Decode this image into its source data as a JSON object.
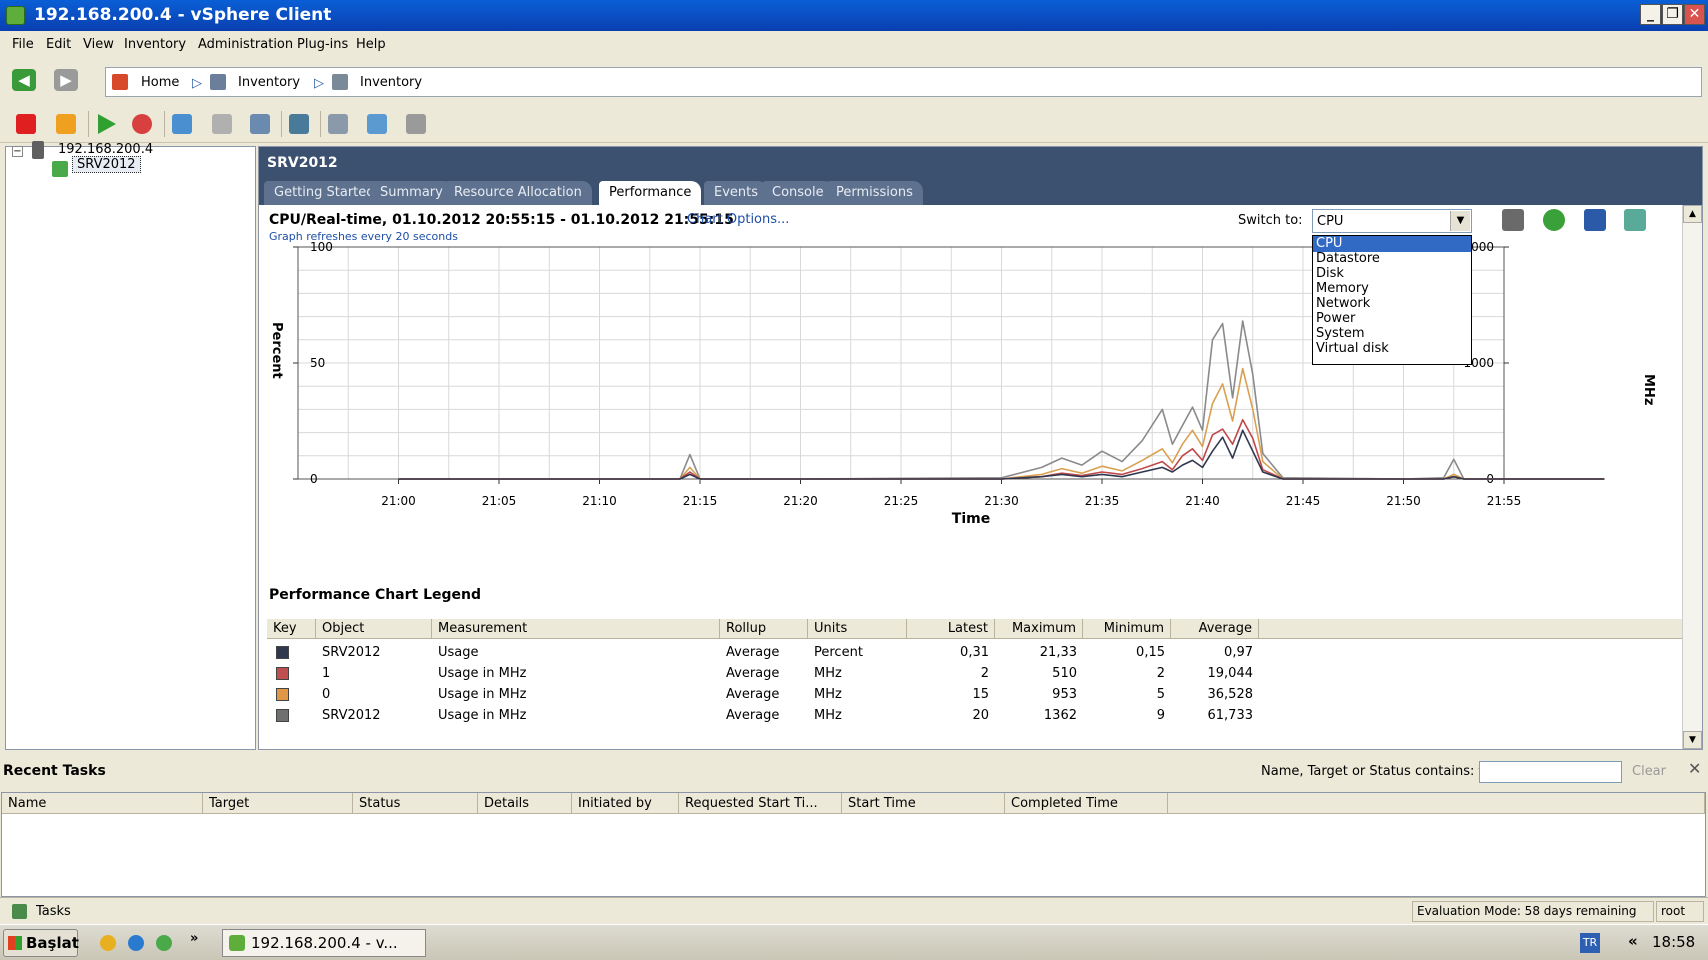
{
  "window": {
    "title": "192.168.200.4 - vSphere Client",
    "min": "_",
    "max": "❐",
    "close": "✕"
  },
  "menu": [
    "File",
    "Edit",
    "View",
    "Inventory",
    "Administration",
    "Plug-ins",
    "Help"
  ],
  "breadcrumb": {
    "home": "Home",
    "item1": "Inventory",
    "item2": "Inventory"
  },
  "tree": {
    "host": "192.168.200.4",
    "vm": "SRV2012",
    "expander": "−"
  },
  "panel": {
    "title": "SRV2012",
    "tabs": [
      "Getting Started",
      "Summary",
      "Resource Allocation",
      "Performance",
      "Events",
      "Console",
      "Permissions"
    ],
    "active_tab": "Performance"
  },
  "chart_header": {
    "title": "CPU/Real-time, 01.10.2012 20:55:15 - 01.10.2012 21:55:15",
    "options_link": "Chart Options...",
    "refresh_note": "Graph refreshes every 20 seconds",
    "switch_label": "Switch to:",
    "switch_value": "CPU",
    "switch_options": [
      "CPU",
      "Datastore",
      "Disk",
      "Memory",
      "Network",
      "Power",
      "System",
      "Virtual disk"
    ]
  },
  "chart_data": {
    "type": "line",
    "xlabel": "Time",
    "ylabel": "Percent",
    "y2label": "MHz",
    "ylim": [
      0,
      100
    ],
    "y2lim": [
      0,
      2000
    ],
    "yticks": [
      "100",
      "50",
      "0"
    ],
    "y2ticks": [
      "2000",
      "1000",
      "0"
    ],
    "xticks": [
      "21:00",
      "21:05",
      "21:10",
      "21:15",
      "21:20",
      "21:25",
      "21:30",
      "21:35",
      "21:40",
      "21:45",
      "21:50",
      "21:55"
    ],
    "x_minutes": [
      0,
      7,
      14,
      14.5,
      15,
      20,
      30,
      32,
      33,
      34,
      35,
      36,
      37,
      38,
      38.5,
      39,
      39.5,
      40,
      40.5,
      41,
      41.5,
      42,
      42.5,
      43,
      44,
      50,
      52,
      52.5,
      53,
      60
    ],
    "series": [
      {
        "name": "SRV2012 Usage",
        "unit": "%",
        "color": "#303850",
        "values": [
          0,
          0,
          0,
          2,
          0,
          0,
          0,
          1,
          2,
          1,
          2,
          1,
          3,
          5,
          3,
          6,
          8,
          5,
          12,
          18,
          9,
          21,
          12,
          3,
          0,
          0,
          0,
          1,
          0,
          0
        ]
      },
      {
        "name": "1 Usage in MHz",
        "unit": "MHz",
        "color": "#c04848",
        "values": [
          0,
          0,
          0,
          60,
          0,
          0,
          0,
          20,
          50,
          30,
          60,
          40,
          90,
          150,
          80,
          200,
          260,
          160,
          380,
          430,
          300,
          510,
          350,
          80,
          0,
          0,
          0,
          20,
          0,
          0
        ]
      },
      {
        "name": "0 Usage in MHz",
        "unit": "MHz",
        "color": "#d8a050",
        "values": [
          0,
          0,
          0,
          100,
          0,
          0,
          0,
          40,
          90,
          50,
          110,
          70,
          160,
          260,
          140,
          300,
          420,
          280,
          650,
          820,
          500,
          953,
          600,
          150,
          0,
          0,
          0,
          40,
          0,
          0
        ]
      },
      {
        "name": "SRV2012 Usage in MHz",
        "unit": "MHz",
        "color": "#8a8a8a",
        "values": [
          0,
          0,
          0,
          210,
          0,
          0,
          10,
          100,
          180,
          120,
          240,
          150,
          330,
          600,
          300,
          460,
          620,
          420,
          1200,
          1340,
          700,
          1362,
          900,
          220,
          10,
          0,
          10,
          170,
          0,
          0
        ]
      }
    ]
  },
  "legend": {
    "title": "Performance Chart Legend",
    "headers": [
      "Key",
      "Object",
      "Measurement",
      "Rollup",
      "Units",
      "Latest",
      "Maximum",
      "Minimum",
      "Average"
    ],
    "rows": [
      {
        "color": "#303850",
        "object": "SRV2012",
        "measurement": "Usage",
        "rollup": "Average",
        "units": "Percent",
        "latest": "0,31",
        "maximum": "21,33",
        "minimum": "0,15",
        "average": "0,97"
      },
      {
        "color": "#c05050",
        "object": "1",
        "measurement": "Usage in MHz",
        "rollup": "Average",
        "units": "MHz",
        "latest": "2",
        "maximum": "510",
        "minimum": "2",
        "average": "19,044"
      },
      {
        "color": "#e09848",
        "object": "0",
        "measurement": "Usage in MHz",
        "rollup": "Average",
        "units": "MHz",
        "latest": "15",
        "maximum": "953",
        "minimum": "5",
        "average": "36,528"
      },
      {
        "color": "#707070",
        "object": "SRV2012",
        "measurement": "Usage in MHz",
        "rollup": "Average",
        "units": "MHz",
        "latest": "20",
        "maximum": "1362",
        "minimum": "9",
        "average": "61,733"
      }
    ]
  },
  "recent_tasks": {
    "title": "Recent Tasks",
    "filter_label": "Name, Target or Status contains: ▾",
    "filter_value": "",
    "clear": "Clear",
    "close": "✕",
    "headers": [
      "Name",
      "Target",
      "Status",
      "Details",
      "Initiated by",
      "Requested Start Ti...",
      "Start Time",
      "Completed Time"
    ]
  },
  "status": {
    "tasks": "Tasks",
    "evaluation": "Evaluation Mode: 58 days remaining",
    "user": "root"
  },
  "taskbar": {
    "start": "Başlat",
    "item": "192.168.200.4 - v...",
    "lang": "TR",
    "clock": "18:58",
    "chevron": "«",
    "more": "»"
  },
  "scroll": {
    "up": "▲",
    "down": "▼"
  }
}
